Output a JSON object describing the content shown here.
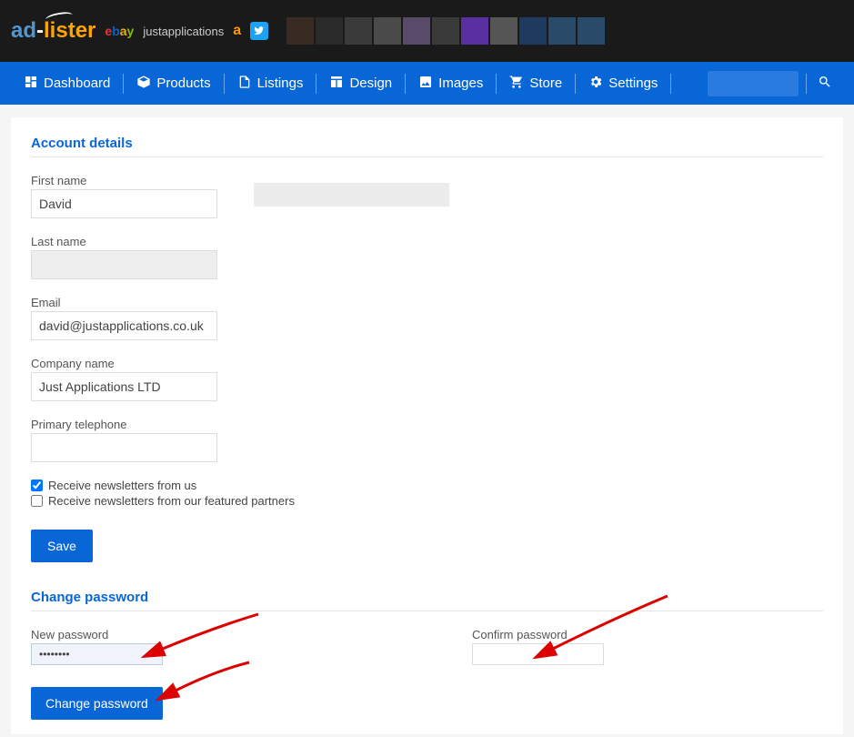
{
  "topbar": {
    "logo_part1": "ad",
    "logo_dash": "-",
    "logo_part2": "lister",
    "ebay_e": "e",
    "ebay_b": "b",
    "ebay_a": "a",
    "ebay_y": "y",
    "just": "justapplications",
    "amazon": "a",
    "swatches": [
      "#3a2a24",
      "#2a2a2a",
      "#3a3a3a",
      "#4a4a4a",
      "#5a4a6a",
      "#3a3a3a",
      "#5a2fa0",
      "#555555",
      "#1e3a5f",
      "#2a4a6a",
      "#2a4a6a"
    ]
  },
  "nav": {
    "dashboard": "Dashboard",
    "products": "Products",
    "listings": "Listings",
    "design": "Design",
    "images": "Images",
    "store": "Store",
    "settings": "Settings"
  },
  "section_account": "Account details",
  "fields": {
    "first_name_label": "First name",
    "first_name_value": "David",
    "last_name_label": "Last name",
    "last_name_value": "",
    "email_label": "Email",
    "email_value": "david@justapplications.co.uk",
    "company_label": "Company name",
    "company_value": "Just Applications LTD",
    "phone_label": "Primary telephone",
    "phone_value": ""
  },
  "checkboxes": {
    "newsletter_us": "Receive newsletters from us",
    "newsletter_us_checked": true,
    "newsletter_partners": "Receive newsletters from our featured partners",
    "newsletter_partners_checked": false
  },
  "buttons": {
    "save": "Save",
    "change_password": "Change password"
  },
  "section_password": "Change password",
  "password": {
    "new_label": "New password",
    "new_value": "••••••••",
    "confirm_label": "Confirm password",
    "confirm_value": ""
  }
}
